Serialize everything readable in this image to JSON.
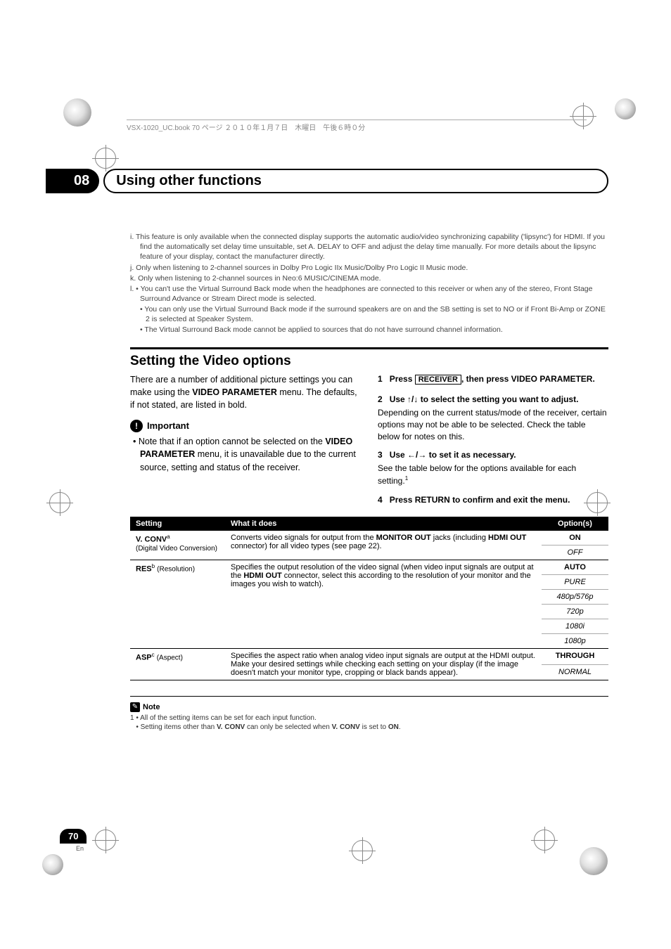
{
  "top_line": "VSX-1020_UC.book  70 ページ  ２０１０年１月７日　木曜日　午後６時０分",
  "chapter": {
    "number": "08",
    "title": "Using other functions"
  },
  "footnotes": [
    {
      "marker": "i.",
      "text": "This feature is only available when the connected display supports the automatic audio/video synchronizing capability ('lipsync') for HDMI. If you find the automatically set delay time unsuitable, set A. DELAY to OFF and adjust the delay time manually. For more details about the lipsync feature of your display, contact the manufacturer directly."
    },
    {
      "marker": "j.",
      "text": "Only when listening to 2-channel sources in Dolby Pro Logic IIx Music/Dolby Pro Logic II Music mode."
    },
    {
      "marker": "k.",
      "text": "Only when listening to 2-channel sources in Neo:6 MUSIC/CINEMA mode."
    },
    {
      "marker": "l.",
      "text": "• You can't use the Virtual Surround Back mode when the headphones are connected to this receiver or when any of the stereo, Front Stage Surround Advance or Stream Direct mode is selected."
    }
  ],
  "footnotes_sub": [
    "• You can only use the Virtual Surround Back mode if the surround speakers are on and the SB setting is set to NO or if Front Bi-Amp or ZONE 2 is selected at Speaker System.",
    "• The Virtual Surround Back mode cannot be applied to sources that do not have surround channel information."
  ],
  "section": {
    "title": "Setting the Video options",
    "intro": "There are a number of additional picture settings you can make using the VIDEO PARAMETER menu. The defaults, if not stated, are listed in bold."
  },
  "important": {
    "label": "Important",
    "bullet": "Note that if an option cannot be selected on the VIDEO PARAMETER menu, it is unavailable due to the current source, setting and status of the receiver."
  },
  "steps": {
    "s1": {
      "num": "1",
      "pre": "Press ",
      "key": "RECEIVER",
      "post": ", then press VIDEO PARAMETER."
    },
    "s2": {
      "num": "2",
      "title": "Use ↑/↓ to select the setting you want to adjust.",
      "body": "Depending on the current status/mode of the receiver, certain options may not be able to be selected. Check the table below for notes on this."
    },
    "s3": {
      "num": "3",
      "title": "Use ←/→ to set it as necessary.",
      "body": "See the table below for the options available for each setting."
    },
    "s4": {
      "num": "4",
      "title": "Press RETURN to confirm and exit the menu."
    }
  },
  "table": {
    "headers": {
      "c1": "Setting",
      "c2": "What it does",
      "c3": "Option(s)"
    },
    "rows": [
      {
        "setting": "V. CONV",
        "sup": "a",
        "paren": "(Digital Video Conversion)",
        "desc": "Converts video signals for output from the MONITOR OUT jacks (including HDMI OUT connector) for all video types (see page 22).",
        "opts": [
          {
            "v": "ON",
            "bold": true
          },
          {
            "v": "OFF"
          }
        ]
      },
      {
        "setting": "RES",
        "sup": "b",
        "paren": "(Resolution)",
        "desc": "Specifies the output resolution of the video signal (when video input signals are output at the HDMI OUT connector, select this according to the resolution of your monitor and the images you wish to watch).",
        "opts": [
          {
            "v": "AUTO",
            "bold": true
          },
          {
            "v": "PURE"
          },
          {
            "v": "480p/576p"
          },
          {
            "v": "720p"
          },
          {
            "v": "1080i"
          },
          {
            "v": "1080p"
          }
        ]
      },
      {
        "setting": "ASP",
        "sup": "c",
        "paren": "(Aspect)",
        "desc": "Specifies the aspect ratio when analog video input signals are output at the HDMI output. Make your desired settings while checking each setting on your display (if the image doesn't match your monitor type, cropping or black bands appear).",
        "opts": [
          {
            "v": "THROUGH",
            "bold": true
          },
          {
            "v": "NORMAL"
          }
        ]
      }
    ]
  },
  "note": {
    "label": "Note",
    "items": [
      "1 • All of the setting items can be set for each input function.",
      "   • Setting items other than V. CONV can only be selected when V. CONV is set to ON."
    ]
  },
  "page": {
    "num": "70",
    "lang": "En"
  }
}
